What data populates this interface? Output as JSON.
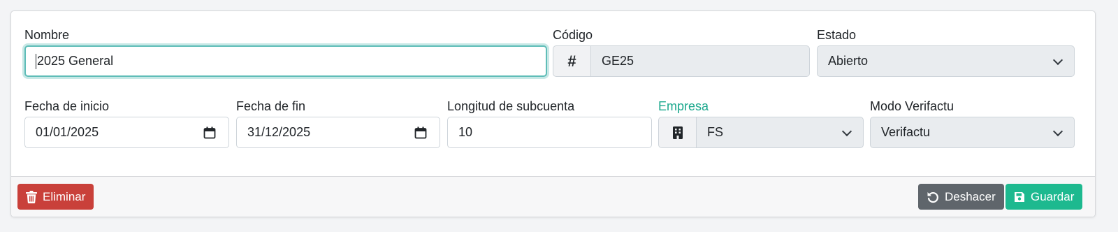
{
  "form": {
    "nombre": {
      "label": "Nombre",
      "value": "2025 General"
    },
    "codigo": {
      "label": "Código",
      "value": "GE25",
      "addon_icon": "hash-icon"
    },
    "estado": {
      "label": "Estado",
      "value": "Abierto"
    },
    "fecha_inicio": {
      "label": "Fecha de inicio",
      "value": "01/01/2025"
    },
    "fecha_fin": {
      "label": "Fecha de fin",
      "value": "31/12/2025"
    },
    "longitud_subcuenta": {
      "label": "Longitud de subcuenta",
      "value": "10"
    },
    "empresa": {
      "label": "Empresa",
      "value": "FS",
      "addon_icon": "building-icon",
      "label_color": "#1ba88d"
    },
    "modo_verifactu": {
      "label": "Modo Verifactu",
      "value": "Verifactu"
    }
  },
  "footer": {
    "delete_label": "Eliminar",
    "undo_label": "Deshacer",
    "save_label": "Guardar"
  },
  "colors": {
    "danger": "#c9403a",
    "secondary": "#5f656b",
    "success": "#1db98f",
    "focus_ring": "#5fbdb8"
  }
}
